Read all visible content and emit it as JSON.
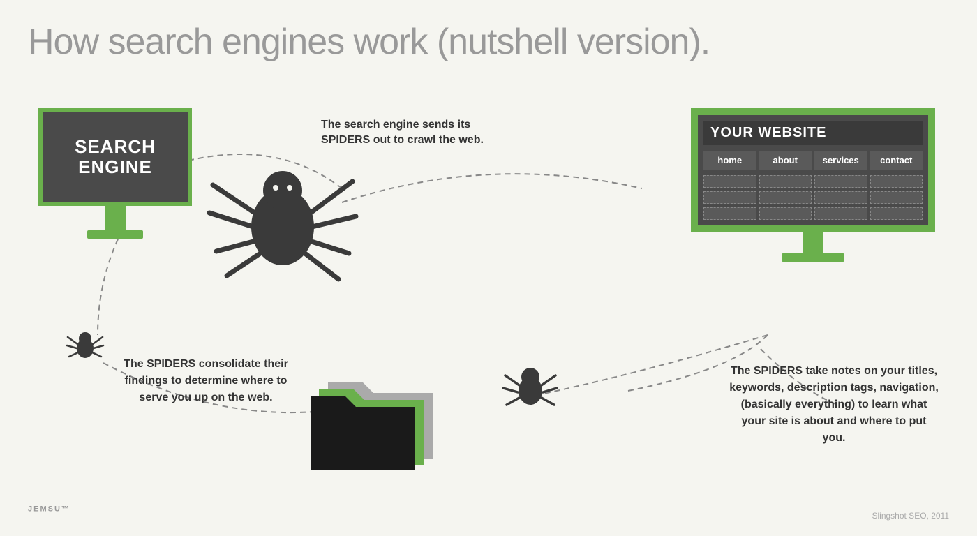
{
  "title": "How search engines work (nutshell version).",
  "search_engine": {
    "label_line1": "SEARCH",
    "label_line2": "ENGINE"
  },
  "website": {
    "title": "YOUR WEBSITE",
    "nav": [
      "home",
      "about",
      "services",
      "contact"
    ]
  },
  "annotations": {
    "top": "The search engine sends its SPIDERS out to crawl the web.",
    "bottom_left": "The SPIDERS consolidate their findings to determine where to serve you up on the web.",
    "bottom_right": "The SPIDERS take notes on your titles, keywords, description tags, navigation, (basically everything) to learn what your site is about and where to put you."
  },
  "logo": "JEMSU",
  "logo_tm": "™",
  "attribution": "Slingshot SEO, 2011",
  "colors": {
    "green": "#6ab04c",
    "dark": "#4a4a4a",
    "bg": "#f5f5f0"
  }
}
